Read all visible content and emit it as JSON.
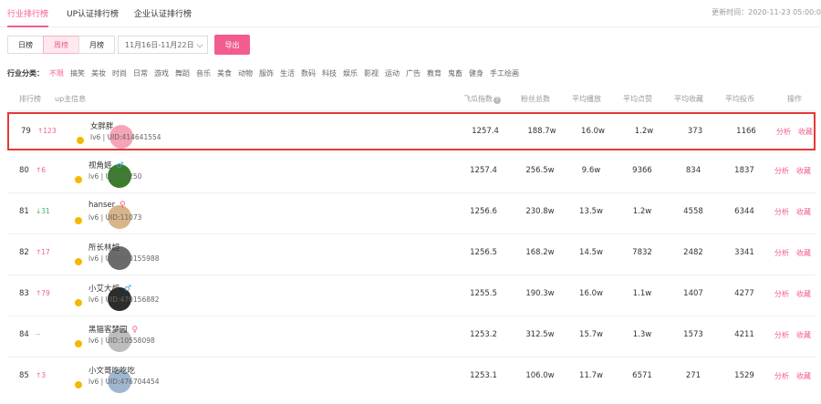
{
  "tabs": [
    "行业排行榜",
    "UP认证排行榜",
    "企业认证排行榜"
  ],
  "updated": "更新时间：2020-11-23 05:00:0",
  "period_tabs": [
    "日榜",
    "周榜",
    "月榜"
  ],
  "date_range": "11月16日-11月22日",
  "export_label": "导出",
  "category_label": "行业分类：",
  "categories": [
    "不限",
    "搞笑",
    "美妆",
    "时尚",
    "日常",
    "游戏",
    "舞蹈",
    "音乐",
    "美食",
    "动物",
    "服饰",
    "生活",
    "数码",
    "科技",
    "娱乐",
    "影视",
    "运动",
    "广告",
    "教育",
    "鬼畜",
    "健身",
    "手工绘画"
  ],
  "headers": [
    "排行榜",
    "up主信息",
    "飞瓜指数",
    "粉丝总数",
    "平均播放",
    "平均点赞",
    "平均收藏",
    "平均投币",
    "操作"
  ],
  "actions": {
    "analyze": "分析",
    "collect": "收藏"
  },
  "rows": [
    {
      "rank": "79",
      "change": "↑123",
      "dir": "up",
      "name": "女胖胖",
      "gender": "",
      "uid": "lv6 | UID:414641554",
      "index": "1257.4",
      "fans": "188.7w",
      "play": "16.0w",
      "like": "1.2w",
      "fav": "373",
      "coin": "1166",
      "avatar_color": "#f5a3b6"
    },
    {
      "rank": "80",
      "change": "↑6",
      "dir": "up",
      "name": "视角姬",
      "gender": "♂",
      "gclass": "m",
      "uid": "lv6 | UID:52250",
      "index": "1257.4",
      "fans": "256.5w",
      "play": "9.6w",
      "like": "9366",
      "fav": "834",
      "coin": "1837",
      "avatar_color": "#3a7d2a"
    },
    {
      "rank": "81",
      "change": "↓31",
      "dir": "down",
      "name": "hanser",
      "gender": "♀",
      "gclass": "f",
      "uid": "lv6 | UID:11073",
      "index": "1256.6",
      "fans": "230.8w",
      "play": "13.5w",
      "like": "1.2w",
      "fav": "4558",
      "coin": "6344",
      "avatar_color": "#d8b48a"
    },
    {
      "rank": "82",
      "change": "↑17",
      "dir": "up",
      "name": "所长林超",
      "gender": "",
      "uid": "lv6 | UID:520155988",
      "index": "1256.5",
      "fans": "168.2w",
      "play": "14.5w",
      "like": "7832",
      "fav": "2482",
      "coin": "3341",
      "avatar_color": "#6b6b6b"
    },
    {
      "rank": "83",
      "change": "↑79",
      "dir": "up",
      "name": "小艾大叔",
      "gender": "♂",
      "gclass": "m",
      "uid": "lv6 | UID:470156882",
      "index": "1255.5",
      "fans": "190.3w",
      "play": "16.0w",
      "like": "1.1w",
      "fav": "1407",
      "coin": "4277",
      "avatar_color": "#2c2c2c"
    },
    {
      "rank": "84",
      "change": "--",
      "dir": "flat",
      "name": "黑猫客梦园",
      "gender": "♀",
      "gclass": "f",
      "uid": "lv6 | UID:10558098",
      "index": "1253.2",
      "fans": "312.5w",
      "play": "15.7w",
      "like": "1.3w",
      "fav": "1573",
      "coin": "4211",
      "avatar_color": "#bdbdbd"
    },
    {
      "rank": "85",
      "change": "↑3",
      "dir": "up",
      "name": "小文哥吃吃吃",
      "gender": "",
      "uid": "lv6 | UID:476704454",
      "index": "1253.1",
      "fans": "106.0w",
      "play": "11.7w",
      "like": "6571",
      "fav": "271",
      "coin": "1529",
      "avatar_color": "#9fb6cf"
    }
  ]
}
